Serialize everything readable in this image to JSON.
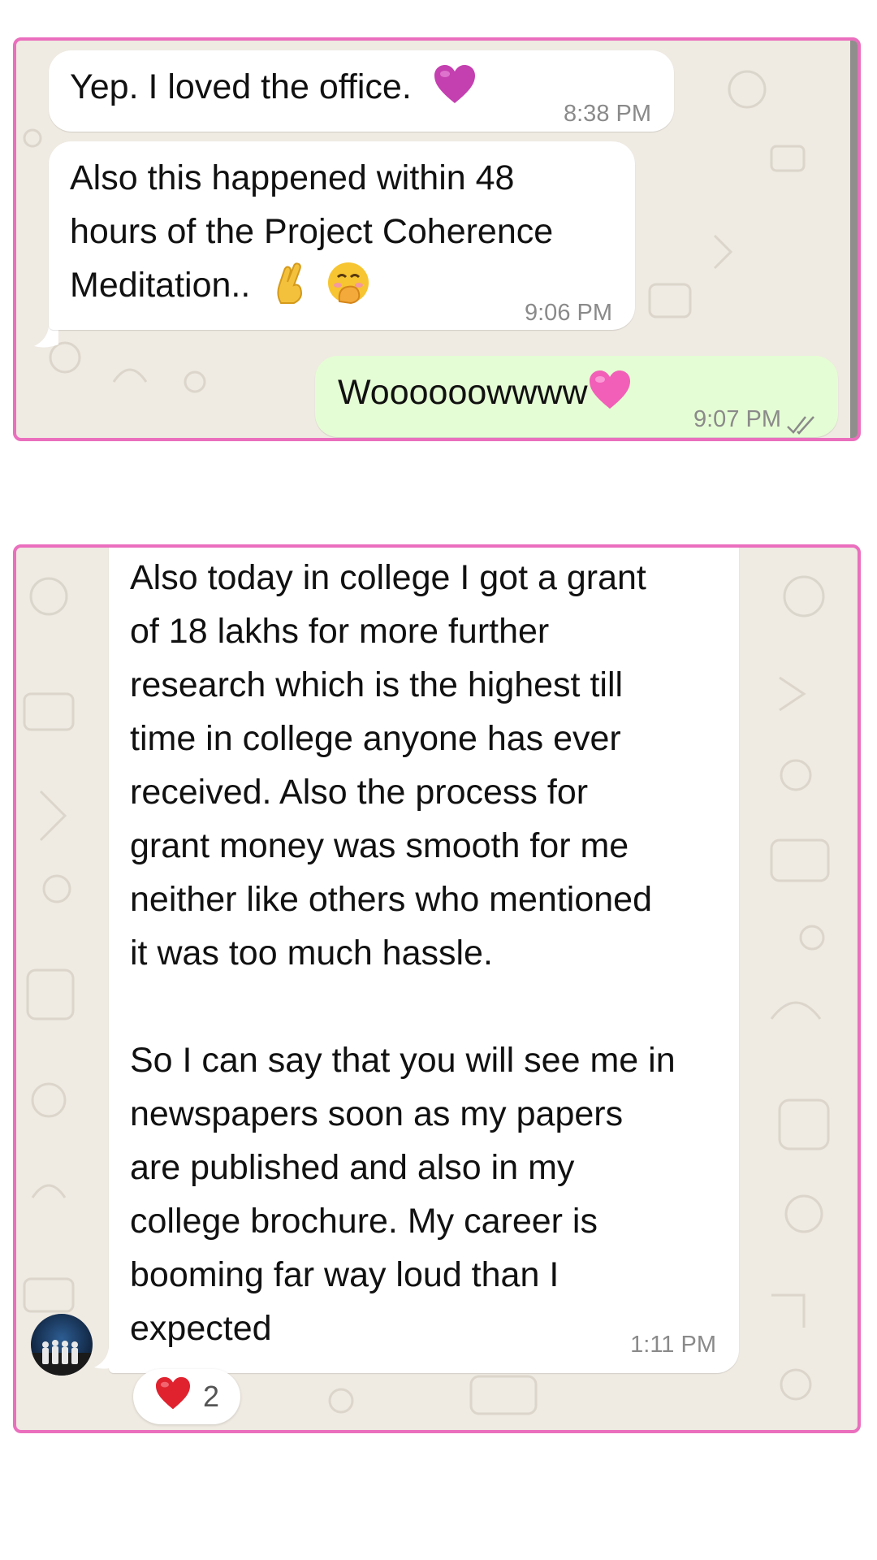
{
  "panel_top": {
    "messages": [
      {
        "direction": "incoming",
        "text": "Yep. I loved the office.",
        "emoji": "purple-heart",
        "time": "8:38 PM"
      },
      {
        "direction": "incoming",
        "text_lines": [
          "Also this happened within 48",
          "hours of the Project Coherence",
          "Meditation.."
        ],
        "emojis": [
          "crossed-fingers",
          "face-with-hand-over-mouth"
        ],
        "time": "9:06 PM"
      },
      {
        "direction": "outgoing",
        "text": "Woooooowwww",
        "emoji": "pink-heart",
        "time": "9:07 PM",
        "status": "double-check-read"
      }
    ]
  },
  "panel_bottom": {
    "message": {
      "direction": "incoming",
      "paragraph1": "Also today in college I got a grant\nof 18 lakhs for more further\nresearch which is the highest till\ntime in college anyone has ever\nreceived. Also the process for\ngrant money was smooth for me\nneither like others who mentioned\nit was too much hassle.",
      "paragraph2": "So I can say that you will see me in\nnewspapers soon as my papers\nare published and also in my\ncollege brochure. My career is\nbooming far way loud than I\nexpected",
      "time": "1:11 PM"
    },
    "reaction": {
      "emoji": "red-heart",
      "count": "2"
    },
    "avatar": "group-photo-avatar"
  },
  "colors": {
    "frame_border": "#ea6fbd",
    "chat_background": "#efeae2",
    "incoming_bubble": "#ffffff",
    "outgoing_bubble": "#e5fdd4",
    "timestamp": "#8a8a8a",
    "read_ticks": "#8a8a8a"
  }
}
